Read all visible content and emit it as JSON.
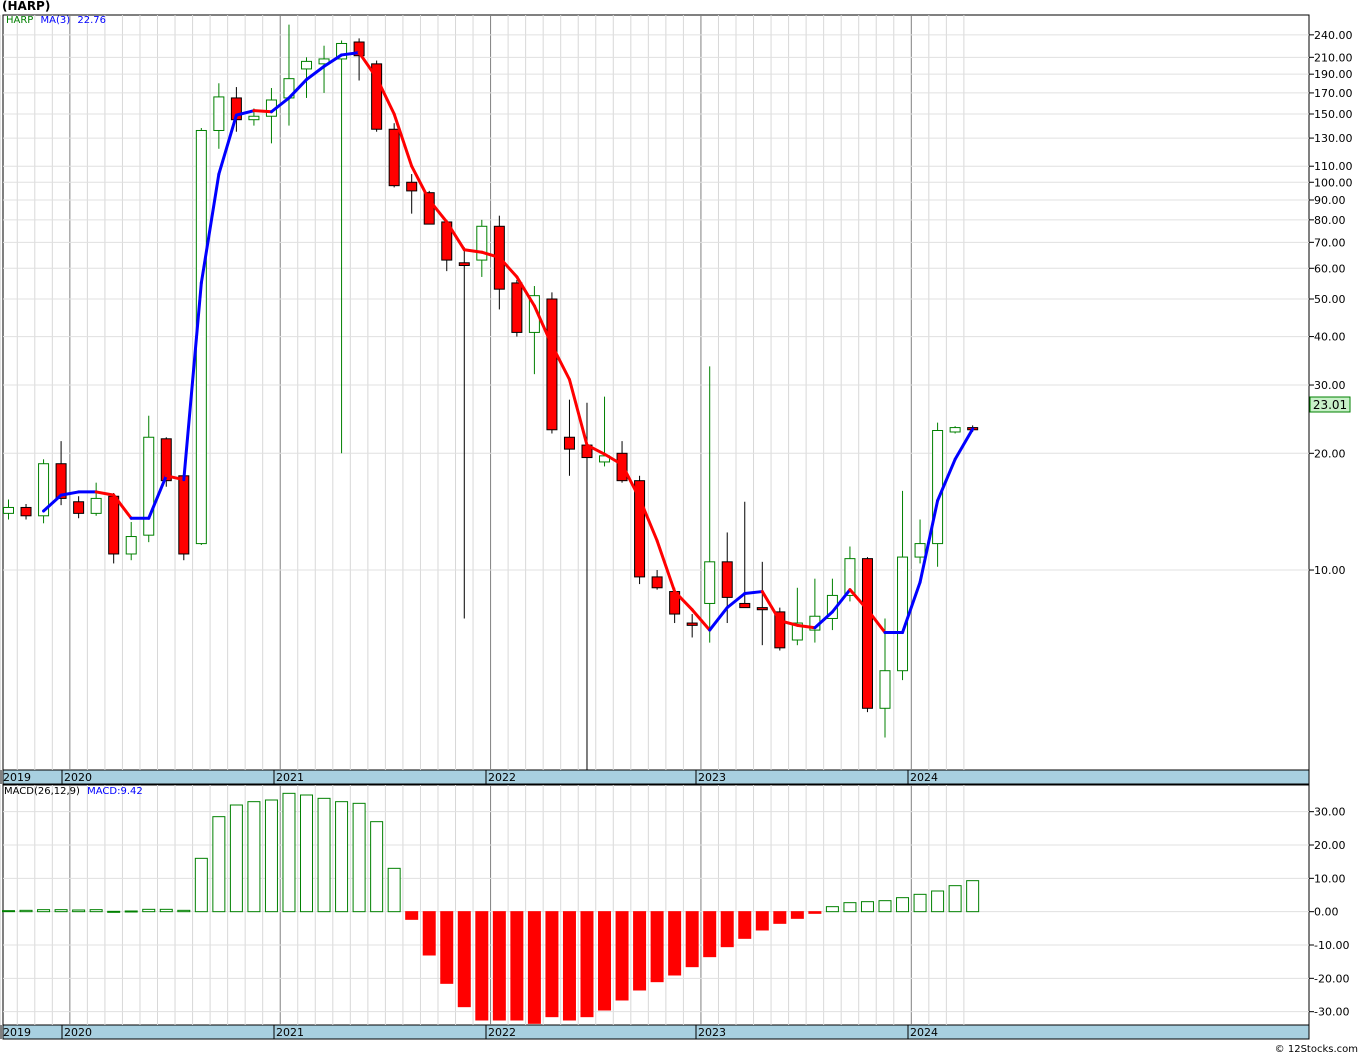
{
  "title": "(HARP)",
  "legend": {
    "ticker": "HARP",
    "ma_label": "MA(3)",
    "ma_value": "22.76",
    "macd_label": "MACD(26,12,9)",
    "macd_value": "MACD:9.42"
  },
  "last_price_label": "23.01",
  "credit": "© 12Stocks.com",
  "colors": {
    "up": "#008000",
    "down": "#ff0000",
    "ma_rising": "#0000ff",
    "ma_falling": "#ff0000",
    "axis_band": "#a8d0e0",
    "grid": "#c0c0c0",
    "price_label_bg": "#c8f0c8"
  },
  "chart_data": [
    {
      "type": "candlestick",
      "scale": "log",
      "ylim": [
        3.05,
        270
      ],
      "y_ticks": [
        "240.00",
        "210.00",
        "190.00",
        "170.00",
        "150.00",
        "130.00",
        "110.00",
        "100.00",
        "90.00",
        "80.00",
        "70.00",
        "60.00",
        "50.00",
        "40.00",
        "30.00",
        "20.00",
        "10.00"
      ],
      "x_labels": [
        "2019",
        "2020",
        "2021",
        "2022",
        "2023",
        "2024"
      ],
      "ma_period": 3,
      "candles": [
        [
          14.0,
          15.2,
          13.5,
          14.5
        ],
        [
          14.5,
          14.8,
          13.5,
          13.8
        ],
        [
          13.8,
          19.3,
          13.2,
          18.8
        ],
        [
          18.8,
          21.5,
          14.7,
          15.3
        ],
        [
          15.0,
          15.5,
          13.6,
          14.0
        ],
        [
          14.0,
          16.8,
          13.8,
          15.3
        ],
        [
          15.5,
          15.8,
          10.4,
          11.0
        ],
        [
          11.0,
          13.3,
          10.6,
          12.2
        ],
        [
          12.3,
          25.0,
          11.8,
          22.0
        ],
        [
          21.8,
          22.0,
          16.4,
          17.0
        ],
        [
          17.5,
          18.0,
          10.6,
          11.0
        ],
        [
          11.7,
          138.0,
          11.6,
          136.0
        ],
        [
          136.0,
          180.0,
          122.0,
          166.0
        ],
        [
          165.0,
          176.0,
          135.0,
          145.0
        ],
        [
          145.0,
          155.0,
          140.0,
          148.0
        ],
        [
          148.0,
          175.0,
          126.0,
          163.0
        ],
        [
          165.0,
          255.0,
          140.0,
          185.0
        ],
        [
          196.0,
          210.0,
          165.0,
          205.0
        ],
        [
          202.0,
          225.0,
          170.0,
          208.0
        ],
        [
          208.0,
          232.0,
          20.0,
          228.0
        ],
        [
          230.0,
          235.0,
          183.0,
          212.0
        ],
        [
          202.0,
          206.0,
          135.0,
          137.0
        ],
        [
          137.0,
          142.0,
          97.0,
          98.0
        ],
        [
          100.0,
          105.0,
          83.0,
          95.0
        ],
        [
          94.0,
          95.0,
          78.0,
          78.0
        ],
        [
          79.0,
          80.0,
          59.0,
          63.0
        ],
        [
          62.0,
          68.0,
          7.5,
          61.0
        ],
        [
          63.0,
          80.0,
          57.0,
          77.0
        ],
        [
          77.0,
          82.0,
          47.0,
          53.0
        ],
        [
          55.0,
          56.0,
          40.0,
          41.0
        ],
        [
          41.0,
          54.0,
          32.0,
          51.0
        ],
        [
          50.0,
          52.0,
          22.5,
          23.0
        ],
        [
          22.0,
          27.5,
          17.5,
          20.5
        ],
        [
          21.0,
          27.0,
          3.05,
          19.5
        ],
        [
          19.0,
          28.0,
          18.5,
          19.7
        ],
        [
          20.0,
          21.5,
          16.8,
          17.0
        ],
        [
          17.0,
          17.5,
          9.2,
          9.6
        ],
        [
          9.6,
          10.0,
          8.9,
          9.0
        ],
        [
          8.8,
          9.0,
          7.3,
          7.7
        ],
        [
          7.3,
          7.7,
          6.7,
          7.2
        ],
        [
          8.2,
          33.5,
          6.5,
          10.5
        ],
        [
          10.5,
          12.5,
          7.3,
          8.5
        ],
        [
          8.2,
          15.0,
          8.0,
          8.0
        ],
        [
          8.0,
          10.5,
          6.4,
          7.9
        ],
        [
          7.8,
          8.0,
          6.2,
          6.3
        ],
        [
          6.6,
          9.0,
          6.4,
          7.3
        ],
        [
          7.0,
          9.5,
          6.5,
          7.6
        ],
        [
          7.5,
          9.5,
          7.0,
          8.6
        ],
        [
          8.6,
          11.5,
          8.3,
          10.7
        ],
        [
          10.7,
          10.8,
          4.3,
          4.4
        ],
        [
          4.4,
          7.5,
          3.7,
          5.5
        ],
        [
          5.5,
          16.0,
          5.2,
          10.8
        ],
        [
          10.8,
          13.5,
          10.4,
          11.7
        ],
        [
          11.7,
          24.0,
          10.2,
          22.9
        ],
        [
          22.7,
          23.5,
          22.5,
          23.3
        ],
        [
          23.3,
          23.6,
          22.7,
          23.0
        ]
      ],
      "ma_values": [
        null,
        null,
        14.2,
        15.6,
        15.9,
        15.9,
        15.6,
        13.6,
        13.6,
        17.5,
        17.1,
        55.0,
        105.0,
        149.0,
        153.0,
        152.0,
        165.0,
        184.0,
        199.0,
        213.0,
        216.0,
        186.0,
        150.0,
        110.0,
        90.0,
        79.0,
        67.0,
        66.0,
        64.0,
        57.0,
        48.0,
        38.0,
        31.0,
        21.0,
        19.9,
        18.7,
        15.3,
        11.9,
        8.8,
        7.9,
        7.0,
        8.0,
        8.7,
        8.8,
        7.4,
        7.2,
        7.1,
        7.8,
        8.9,
        7.9,
        6.9,
        6.9,
        9.3,
        15.1,
        19.3,
        23.1
      ]
    },
    {
      "type": "bar",
      "name": "MACD",
      "ylim": [
        -34,
        38
      ],
      "y_ticks": [
        "30.00",
        "20.00",
        "10.00",
        "0.00",
        "-10.00",
        "-20.00",
        "-30.00"
      ],
      "x_labels": [
        "2019",
        "2020",
        "2021",
        "2022",
        "2023",
        "2024"
      ],
      "values": [
        0.3,
        0.4,
        0.6,
        0.6,
        0.5,
        0.6,
        0.1,
        0.2,
        0.7,
        0.7,
        0.4,
        16.0,
        28.5,
        32.0,
        33.0,
        33.5,
        35.5,
        35.0,
        34.0,
        33.0,
        32.5,
        27.0,
        13.0,
        -2.3,
        -13.0,
        -21.5,
        -28.5,
        -32.5,
        -32.5,
        -32.5,
        -33.5,
        -31.5,
        -32.5,
        -31.5,
        -29.5,
        -26.5,
        -23.5,
        -21.0,
        -19.0,
        -16.5,
        -13.5,
        -10.5,
        -8.0,
        -5.5,
        -3.5,
        -2.0,
        -0.5,
        1.5,
        2.7,
        3.0,
        3.3,
        4.2,
        5.2,
        6.2,
        7.8,
        9.3
      ]
    }
  ]
}
